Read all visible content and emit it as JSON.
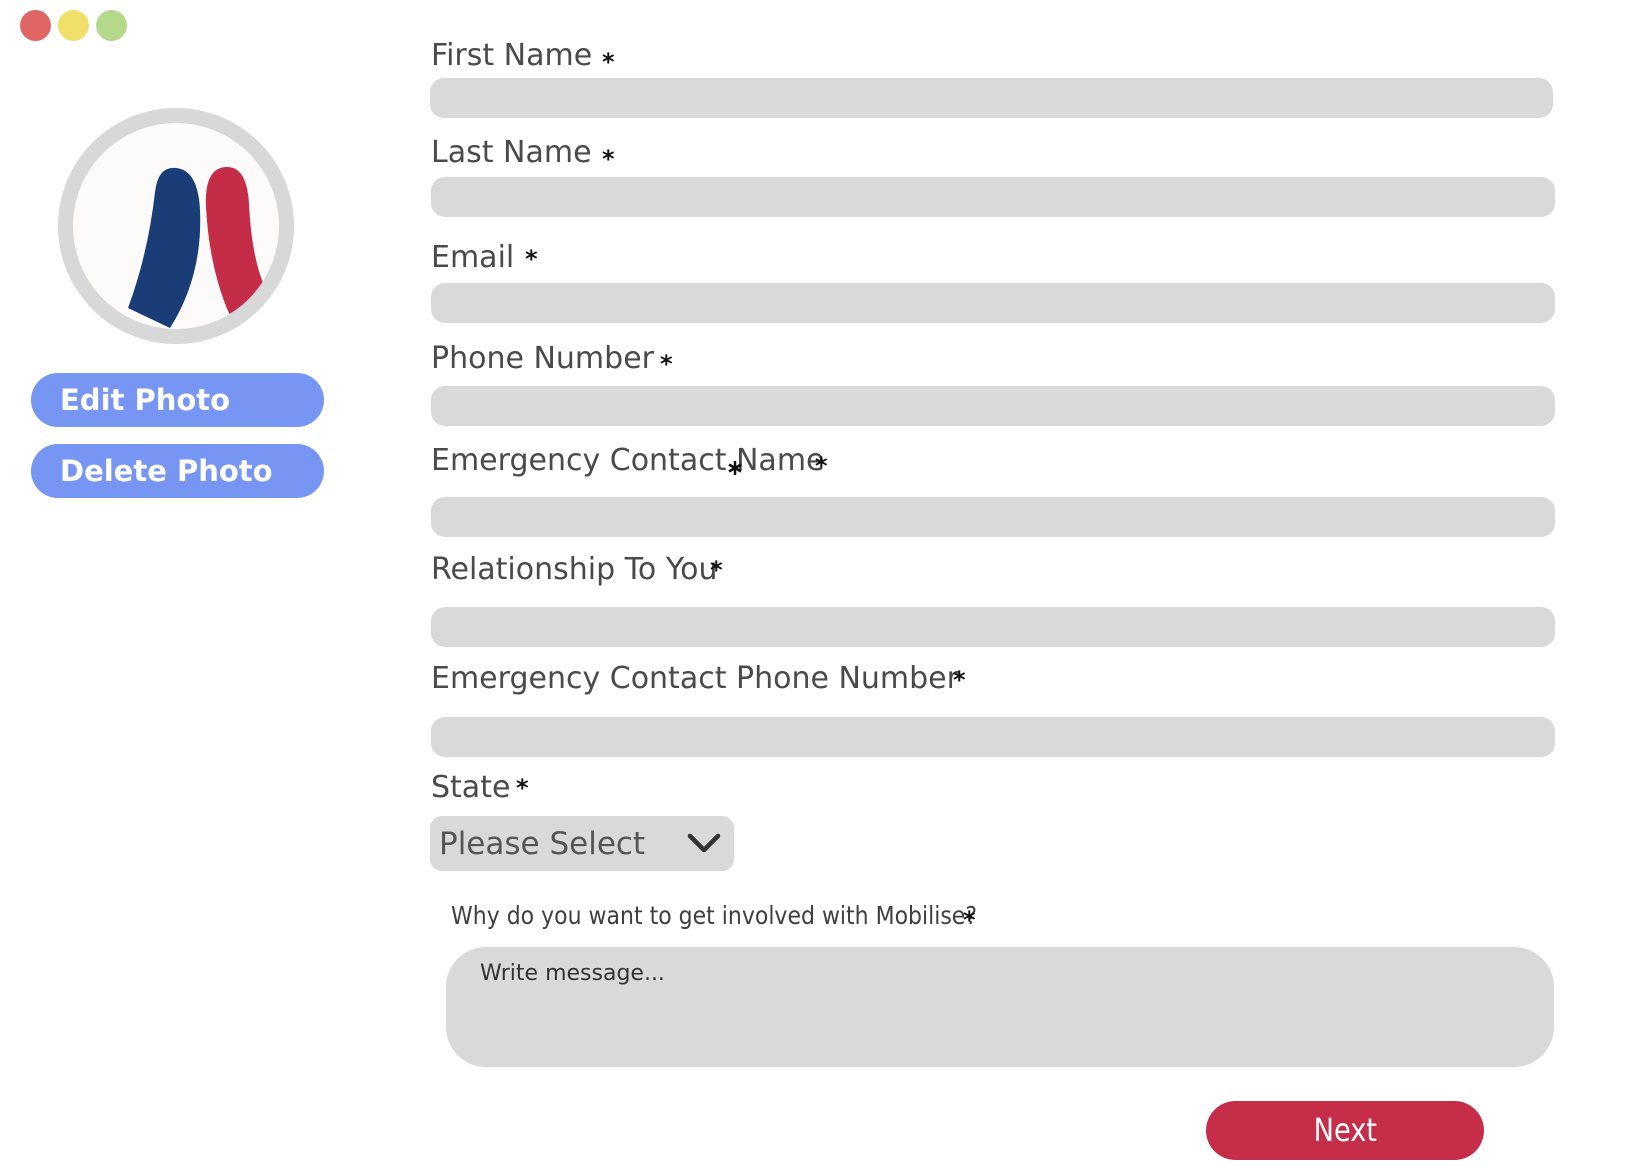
{
  "window": {
    "controls": [
      "close",
      "minimize",
      "maximize"
    ],
    "colors": {
      "close": "#e06666",
      "minimize": "#f1df6b",
      "maximize": "#b4d98b"
    }
  },
  "profile": {
    "avatar_icon": "mobilise-logo-icon",
    "logo_colors": {
      "left": "#1a3d78",
      "right": "#c52c48"
    },
    "edit_photo_label": "Edit Photo",
    "delete_photo_label": "Delete Photo"
  },
  "form": {
    "required_mark": "*",
    "fields": [
      {
        "label": "First Name",
        "value": ""
      },
      {
        "label": "Last Name",
        "value": ""
      },
      {
        "label": "Email",
        "value": ""
      },
      {
        "label": "Phone Number",
        "value": ""
      },
      {
        "label": "Emergency Contact Name",
        "value": ""
      },
      {
        "label": "Relationship To You",
        "value": ""
      },
      {
        "label": "Emergency Contact Phone Number",
        "value": ""
      }
    ],
    "state": {
      "label": "State",
      "selected": "Please Select"
    },
    "question": {
      "label": "Why do you want to get involved with Mobilise?",
      "placeholder": "Write message...",
      "value": ""
    },
    "next_label": "Next"
  },
  "colors": {
    "primary_button": "#7795f3",
    "next_button": "#c62d48",
    "input_background": "#d9d9d9"
  }
}
